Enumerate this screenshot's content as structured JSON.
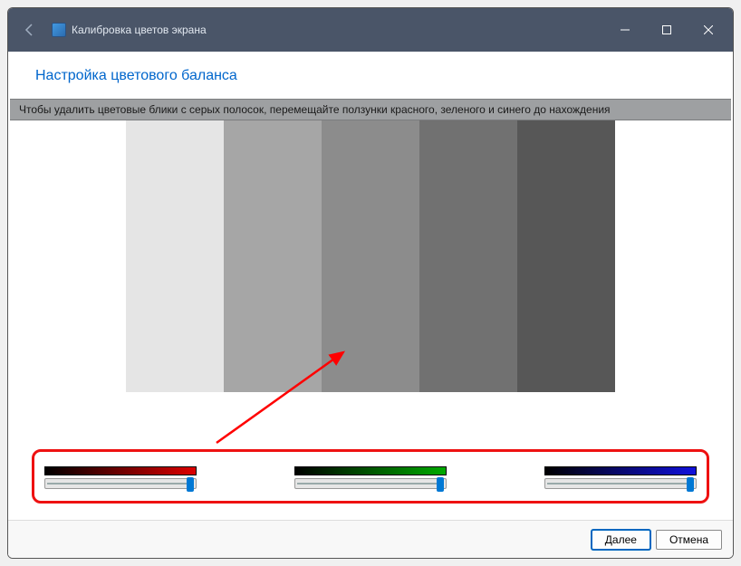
{
  "titlebar": {
    "title": "Калибровка цветов экрана"
  },
  "page": {
    "title": "Настройка цветового баланса",
    "instruction": "Чтобы удалить цветовые блики с серых полосок, перемещайте ползунки красного, зеленого и синего до нахождения"
  },
  "gray_strips": [
    "#e5e5e5",
    "#a6a6a6",
    "#8c8c8c",
    "#717171",
    "#575757"
  ],
  "sliders": {
    "red": {
      "value": 100,
      "gradient": [
        "#000000",
        "#dd0000"
      ]
    },
    "green": {
      "value": 100,
      "gradient": [
        "#000000",
        "#00aa00"
      ]
    },
    "blue": {
      "value": 100,
      "gradient": [
        "#000000",
        "#1111dd"
      ]
    }
  },
  "footer": {
    "next": "Далее",
    "cancel": "Отмена"
  },
  "annotation": {
    "highlight_color": "#ee1111",
    "arrow_color": "#ff0000"
  }
}
